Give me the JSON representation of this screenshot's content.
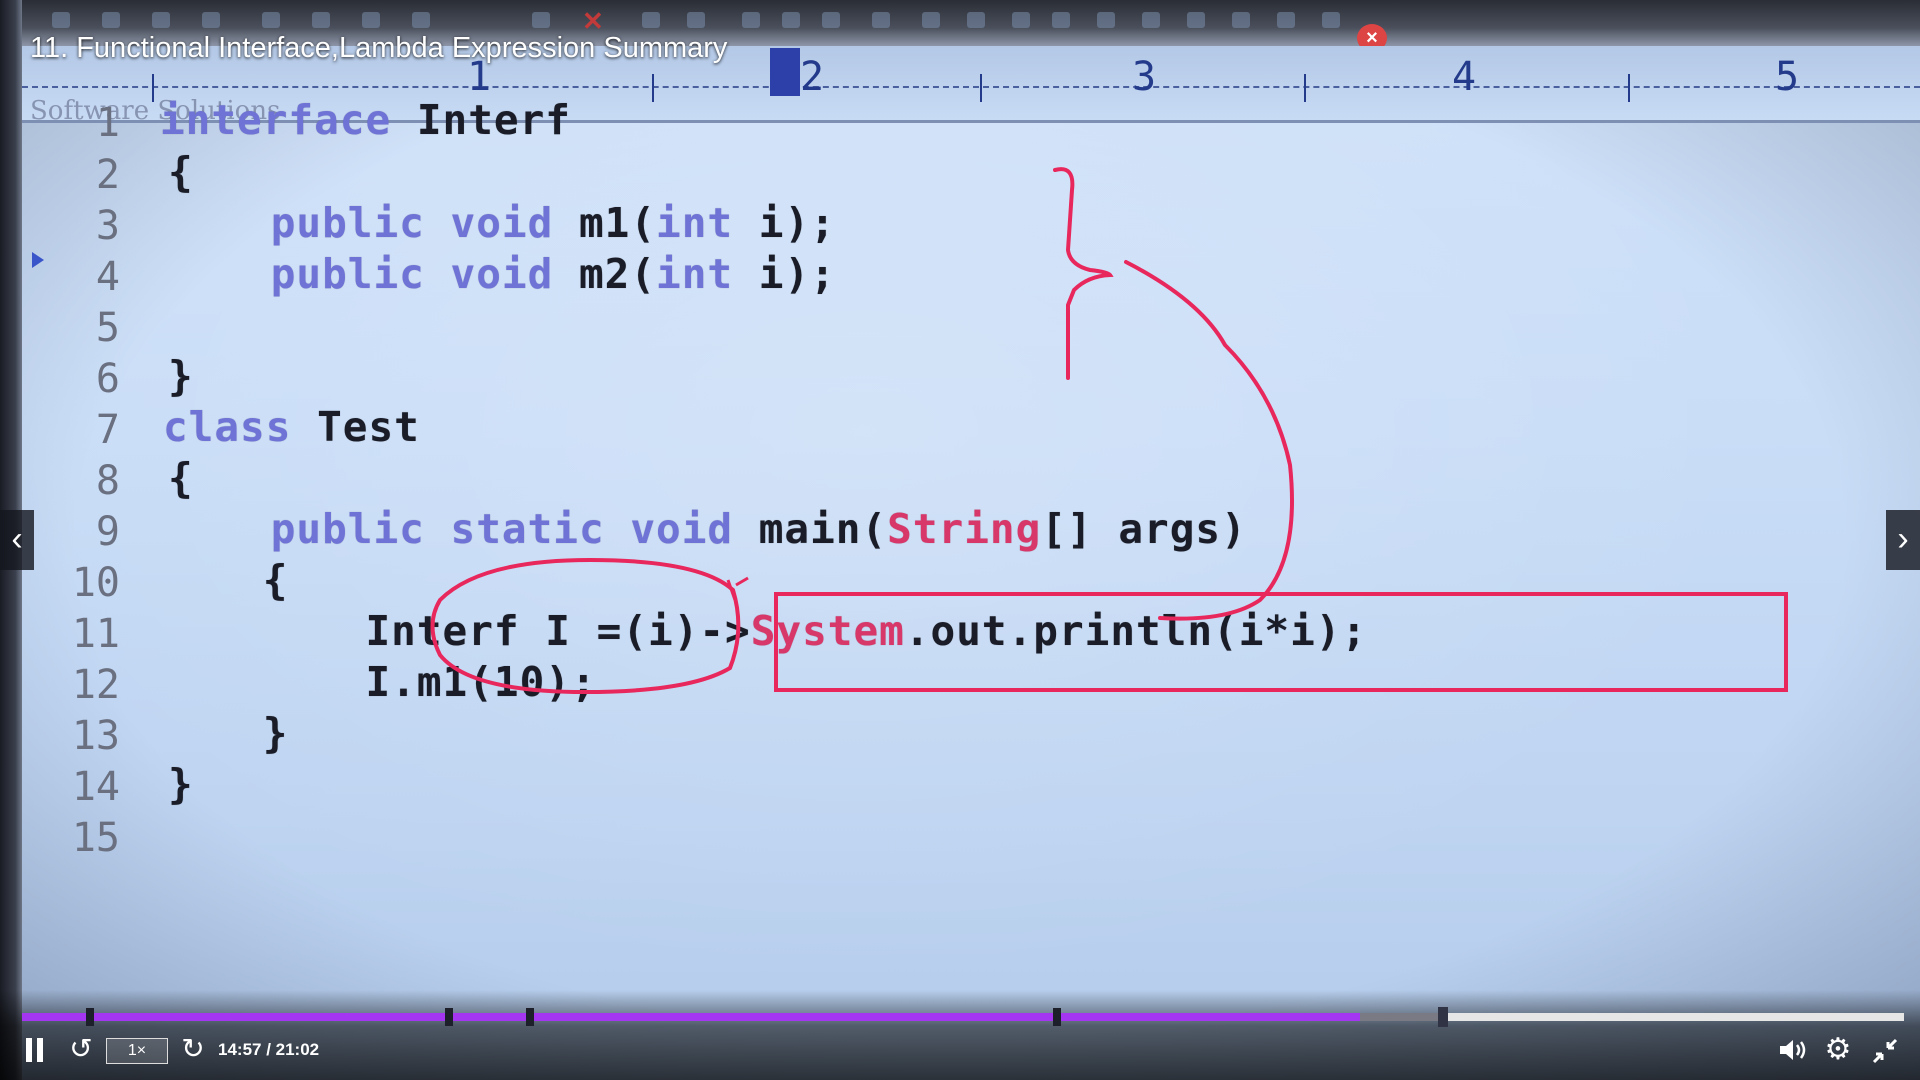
{
  "video": {
    "title": "11. Functional Interface,Lambda Expression Summary"
  },
  "editor": {
    "watermark": "Software Solutions",
    "ruler": [
      "1",
      "2",
      "3",
      "4",
      "5"
    ],
    "lines": [
      {
        "num": "1",
        "tokens": [
          {
            "t": "interface ",
            "kw": true
          },
          {
            "t": "Interf"
          }
        ]
      },
      {
        "num": "2",
        "tokens": [
          {
            "t": "{"
          }
        ]
      },
      {
        "num": "3",
        "tokens": [
          {
            "t": "    "
          },
          {
            "t": "public void ",
            "kw": true
          },
          {
            "t": "m1("
          },
          {
            "t": "int ",
            "kw": true
          },
          {
            "t": "i);"
          }
        ]
      },
      {
        "num": "4",
        "tokens": [
          {
            "t": "    "
          },
          {
            "t": "public void ",
            "kw": true
          },
          {
            "t": "m2("
          },
          {
            "t": "int ",
            "kw": true
          },
          {
            "t": "i);"
          }
        ]
      },
      {
        "num": "5",
        "tokens": []
      },
      {
        "num": "6",
        "tokens": [
          {
            "t": "}"
          }
        ]
      },
      {
        "num": "7",
        "tokens": [
          {
            "t": "class ",
            "kw": true
          },
          {
            "t": "Test"
          }
        ]
      },
      {
        "num": "8",
        "tokens": [
          {
            "t": "{"
          }
        ]
      },
      {
        "num": "9",
        "tokens": [
          {
            "t": "    "
          },
          {
            "t": "public static void ",
            "kw": true
          },
          {
            "t": "main("
          },
          {
            "t": "String",
            "str": true
          },
          {
            "t": "[] args)"
          }
        ]
      },
      {
        "num": "10",
        "tokens": [
          {
            "t": "    {"
          }
        ]
      },
      {
        "num": "11",
        "tokens": [
          {
            "t": "        Interf I =(i)->"
          },
          {
            "t": "System",
            "str": true
          },
          {
            "t": ".out.println(i*i);"
          }
        ]
      },
      {
        "num": "12",
        "tokens": [
          {
            "t": "        I.m1(10);"
          }
        ]
      },
      {
        "num": "13",
        "tokens": [
          {
            "t": "    }"
          }
        ]
      },
      {
        "num": "14",
        "tokens": [
          {
            "t": "}"
          }
        ]
      },
      {
        "num": "15",
        "tokens": []
      }
    ]
  },
  "nav": {
    "prev_icon": "chevron-left-icon",
    "next_icon": "chevron-right-icon"
  },
  "player": {
    "current_time": "14:57",
    "duration": "21:02",
    "time_label": "14:57 / 21:02",
    "playback_rate": "1×",
    "played_fraction": 0.711,
    "buffered_fraction": 0.755,
    "chapter_marks_fraction": [
      0.036,
      0.227,
      0.27,
      0.55
    ],
    "accent_color": "#a435f0",
    "icons": [
      "pause-icon",
      "rewind-icon",
      "forward-icon",
      "volume-icon",
      "settings-icon",
      "fullscreen-exit-icon"
    ]
  }
}
